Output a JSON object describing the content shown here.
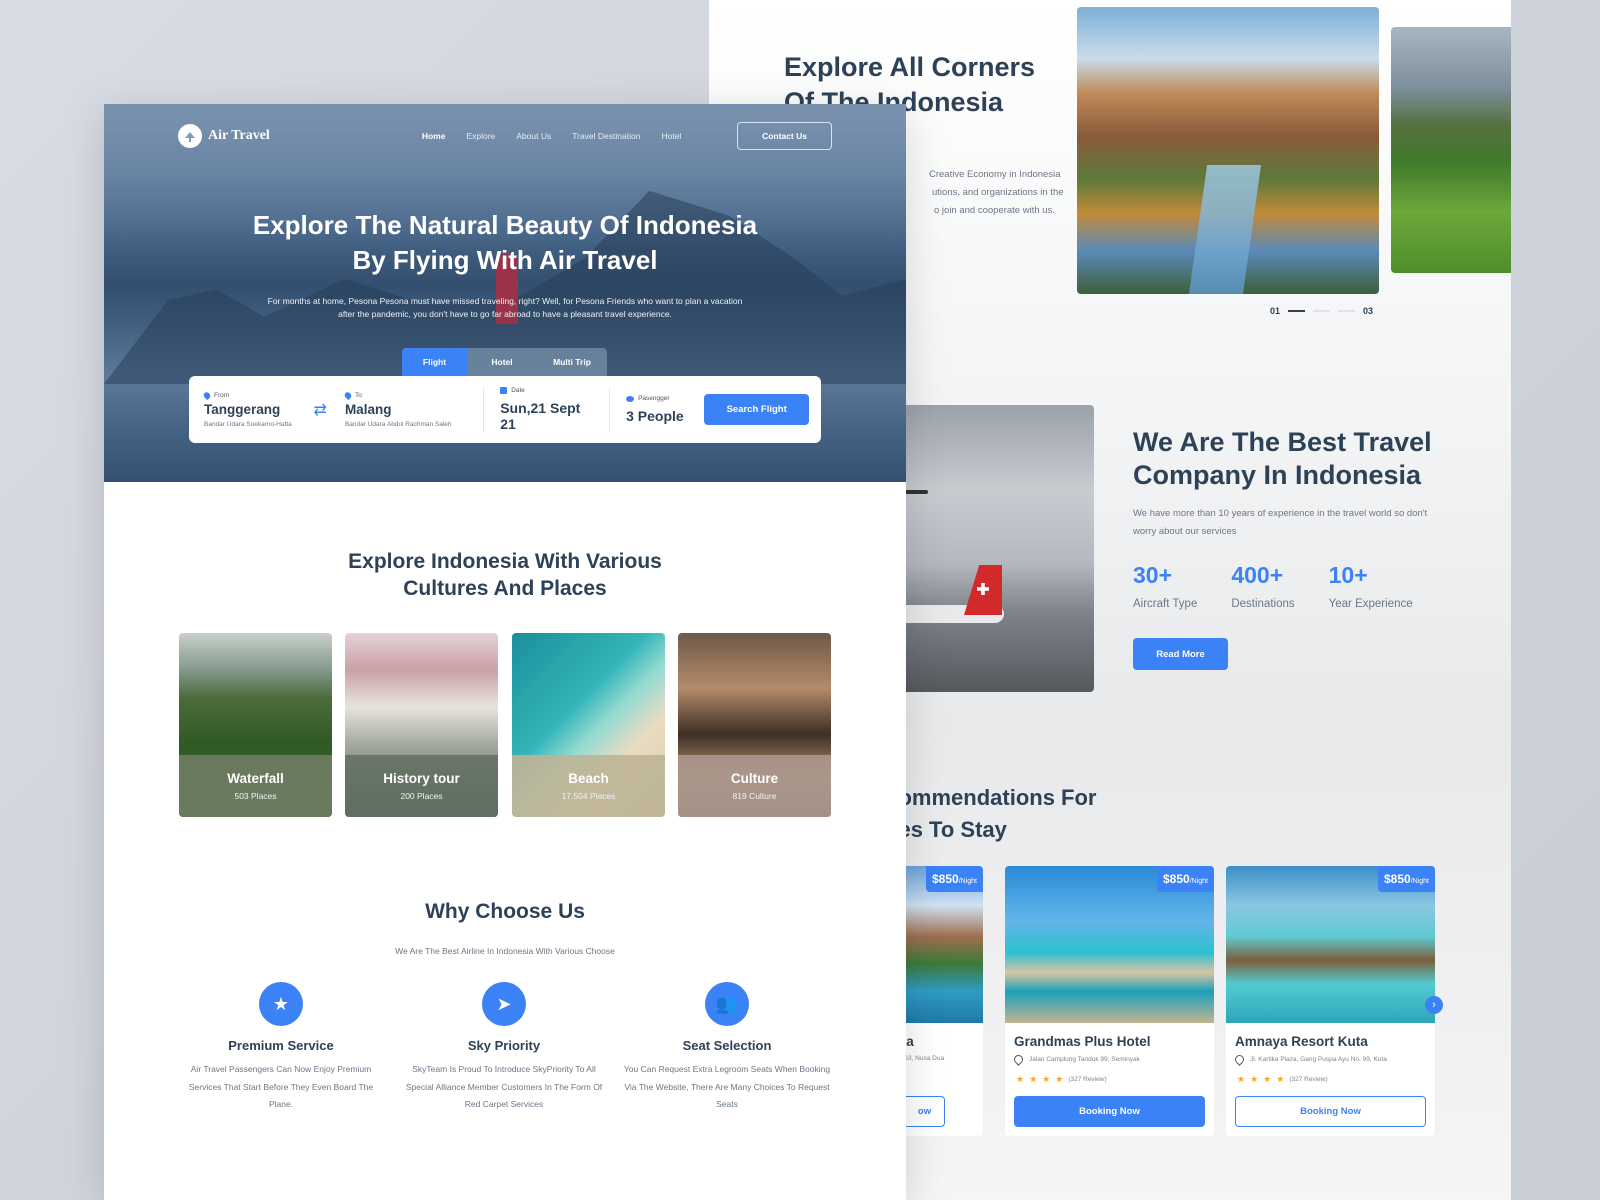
{
  "back_panel": {
    "explore": {
      "title": "Explore All Corners Of The Indonesia",
      "desc_lines": [
        "Creative Economy in Indonesia",
        "utions, and organizations in the",
        "o join and cooperate with us."
      ],
      "pager": {
        "current": "01",
        "total": "03"
      }
    },
    "about": {
      "title": "We Are The Best Travel Company In Indonesia",
      "desc": "We have more than 10 years of experience in the travel world so don't worry about our services",
      "stats": [
        {
          "value": "30+",
          "label": "Aircraft Type"
        },
        {
          "value": "400+",
          "label": "Destinations"
        },
        {
          "value": "10+",
          "label": "Year Experience"
        }
      ],
      "read_more": "Read More"
    },
    "recommendations": {
      "title_line1": "ecommendations For",
      "title_line2": "aces To Stay",
      "hotels": [
        {
          "name": "ua",
          "address": "t S3, Nusa Dua",
          "price": "$850",
          "per": "/Night",
          "booking": "ow"
        },
        {
          "name": "Grandmas Plus Hotel",
          "address": "Jalan Camplung Tanduk 99, Seminyak",
          "price": "$850",
          "per": "/Night",
          "stars": 4,
          "reviews": "(327 Review)",
          "booking": "Booking Now"
        },
        {
          "name": "Amnaya Resort Kuta",
          "address": "Jl. Kartika Plaza, Gang Puspa Ayu No. 99, Kuta",
          "price": "$850",
          "per": "/Night",
          "stars": 4,
          "reviews": "(327 Review)",
          "booking": "Booking Now"
        }
      ],
      "next_icon": "chevron-right"
    }
  },
  "front_panel": {
    "brand": "Air Travel",
    "nav": [
      "Home",
      "Explore",
      "About Us",
      "Travel Destination",
      "Hotel"
    ],
    "contact": "Contact Us",
    "hero": {
      "title_line1": "Explore The Natural Beauty Of Indonesia",
      "title_line2": "By Flying With Air Travel",
      "desc_line1": "For months at home, Pesona Pesona must have missed traveling, right? Well, for Pesona Friends who want to plan a vacation",
      "desc_line2": "after the pandemic, you don't have to go far abroad to have a pleasant travel experience."
    },
    "tabs": [
      "Flight",
      "Hotel",
      "Multi Trip"
    ],
    "search": {
      "from": {
        "label": "From",
        "value": "Tanggerang",
        "sub": "Bandar Udara Soekarno-Hatta"
      },
      "to": {
        "label": "To",
        "value": "Malang",
        "sub": "Bandar Udara Abdul Rachman Saleh"
      },
      "date": {
        "label": "Date",
        "value": "Sun,21 Sept 21"
      },
      "passenger": {
        "label": "Pasengger",
        "value": "3 People"
      },
      "button": "Search Flight"
    },
    "categories_title_line1": "Explore Indonesia With Various",
    "categories_title_line2": "Cultures And Places",
    "categories": [
      {
        "name": "Waterfall",
        "count": "503 Places"
      },
      {
        "name": "History tour",
        "count": "200 Places"
      },
      {
        "name": "Beach",
        "count": "17.504 Places"
      },
      {
        "name": "Culture",
        "count": "819 Culture"
      }
    ],
    "why": {
      "title": "Why Choose Us",
      "subtitle": "We Are The Best Airline In Indonesia With Various Choose",
      "features": [
        {
          "icon": "star",
          "title": "Premium Service",
          "desc": "Air Travel Passengers Can Now Enjoy Premium Services That Start Before They Even Board The Plane."
        },
        {
          "icon": "paper-plane",
          "title": "Sky Priority",
          "desc": "SkyTeam Is Proud To Introduce SkyPriority To All Special Alliance Member Customers In The Form Of Red Carpet Services"
        },
        {
          "icon": "users",
          "title": "Seat Selection",
          "desc": "You Can Request Extra Legroom Seats When Booking Via The Website, There Are Many Choices To Request Seats"
        }
      ]
    }
  },
  "colors": {
    "accent": "#3b82f6",
    "heading": "#2e4257",
    "muted": "#6b7785"
  }
}
